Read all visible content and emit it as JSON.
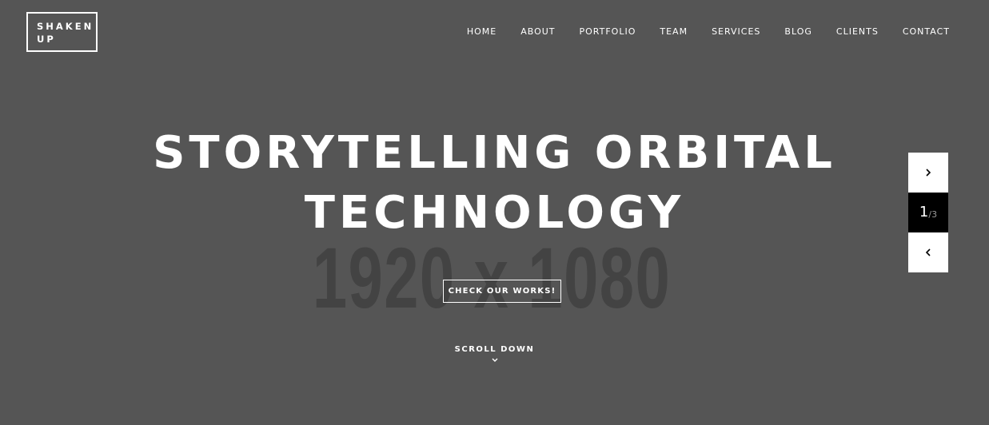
{
  "placeholder": {
    "size_text": "1920 x 1080"
  },
  "brand": {
    "line1": "SHAKEN",
    "line2": "UP"
  },
  "nav": {
    "items": [
      "HOME",
      "ABOUT",
      "PORTFOLIO",
      "TEAM",
      "SERVICES",
      "BLOG",
      "CLIENTS",
      "CONTACT"
    ]
  },
  "hero": {
    "headline_line1": "STORYTELLING ORBITAL",
    "headline_line2": "TECHNOLOGY",
    "cta_label": "CHECK OUR WORKS!",
    "scroll_label": "SCROLL DOWN"
  },
  "slider": {
    "current": "1",
    "separator": "/",
    "total": "3",
    "next_icon": "chevron-right-icon",
    "prev_icon": "chevron-left-icon"
  },
  "colors": {
    "background": "#555555",
    "placeholder_text": "#434343",
    "foreground": "#ffffff",
    "counter_bg": "#000000"
  }
}
